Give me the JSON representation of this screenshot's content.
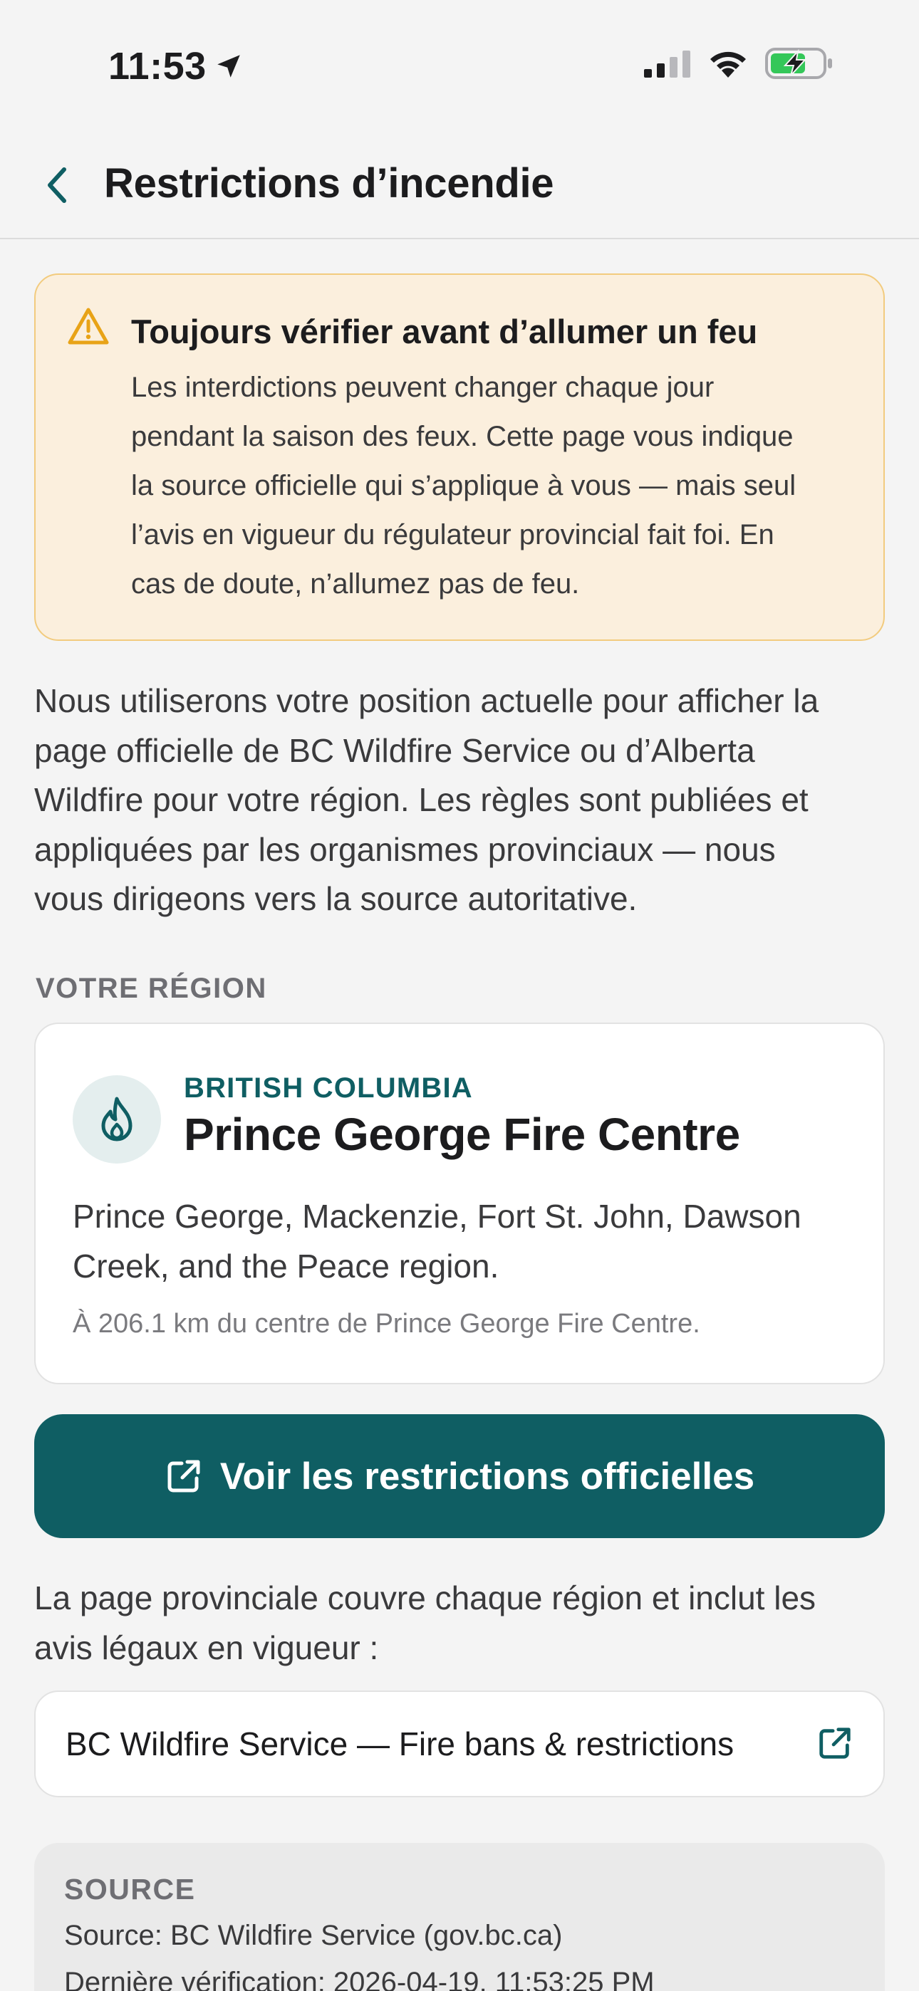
{
  "status_bar": {
    "time": "11:53",
    "icons": [
      "location-arrow-icon",
      "cellular-signal-icon",
      "wifi-icon",
      "battery-charging-icon"
    ]
  },
  "nav": {
    "back_icon": "chevron-left-icon",
    "title": "Restrictions d’incendie"
  },
  "warning": {
    "icon": "warning-triangle-icon",
    "title": "Toujours vérifier avant d’allumer un feu",
    "lines": [
      "Les interdictions peuvent changer chaque jour",
      "pendant la saison des feux. Cette page vous indique",
      "la source officielle qui s’applique à vous — mais seul",
      "l’avis en vigueur du régulateur provincial fait foi. En",
      "cas de doute, n’allumez pas de feu."
    ]
  },
  "intro": {
    "lines": [
      "Nous utiliserons votre position actuelle pour afficher la",
      "page officielle de BC Wildfire Service ou d’Alberta",
      "Wildfire pour votre région. Les règles sont publiées et",
      "appliquées par les organismes provinciaux — nous",
      "vous dirigeons vers la source autoritative."
    ]
  },
  "region": {
    "section_label": "VOTRE RÉGION",
    "icon": "flame-icon",
    "province": "BRITISH COLUMBIA",
    "name": "Prince George Fire Centre",
    "desc_lines": [
      "Prince George, Mackenzie, Fort St. John, Dawson",
      "Creek, and the Peace region."
    ],
    "distance": "À 206.1 km du centre de Prince George Fire Centre."
  },
  "cta": {
    "icon": "external-link-icon",
    "label": "Voir les restrictions officielles"
  },
  "coverage": {
    "lines": [
      "La page provinciale couvre chaque région et inclut les",
      "avis légaux en vigueur :"
    ]
  },
  "link": {
    "label": "BC Wildfire Service — Fire bans & restrictions",
    "icon": "external-link-icon"
  },
  "source": {
    "label": "SOURCE",
    "line": "Source: BC Wildfire Service (gov.bc.ca)",
    "verified": "Dernière vérification: 2026-04-19, 11:53:25 PM"
  },
  "colors": {
    "accent": "#0F5E63",
    "warning_bg": "#FBEFDD",
    "warning_border": "#F2CB7E",
    "warning_icon": "#E8A317",
    "battery_green": "#34C759"
  }
}
